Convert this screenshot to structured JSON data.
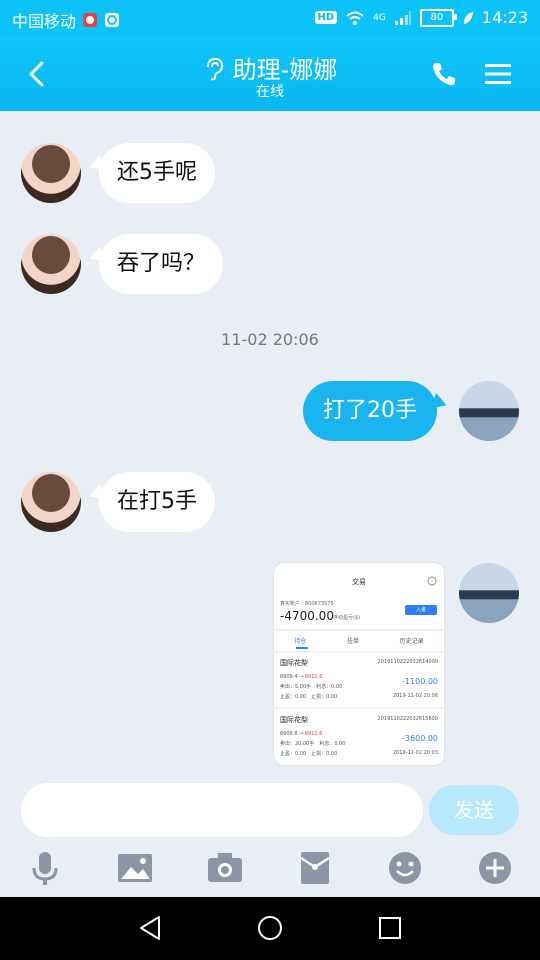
{
  "status_bar": {
    "carrier": "中国移动",
    "hd": "HD",
    "network": "4G",
    "battery": "80",
    "time": "14:23"
  },
  "header": {
    "title": "助理-娜娜",
    "subtitle": "在线"
  },
  "messages": [
    {
      "side": "in",
      "text": "还5手呢"
    },
    {
      "side": "in",
      "text": "吞了吗？"
    },
    {
      "timestamp": "11-02 20:06"
    },
    {
      "side": "out",
      "text": "打了20手"
    },
    {
      "side": "in",
      "text": "在打5手"
    }
  ],
  "trade_screenshot": {
    "title": "交易",
    "account_label": "真实账户：800673575",
    "balance": "-4700.00",
    "float_label": "浮动盈亏($)",
    "button": "入金",
    "tabs": [
      "持仓",
      "挂单",
      "历史记录"
    ],
    "orders": [
      {
        "name": "国际花梨",
        "order_no": "2019110222032614000",
        "open": "8909.4",
        "current": "8911.6",
        "lots_label": "卖出：5.00手",
        "profit_label": "利息：0.00",
        "stop_label": "止损：0.00",
        "take_label": "止盈：0.00",
        "pl": "-1100.00",
        "time": "2019-11-02 20:06"
      },
      {
        "name": "国际花梨",
        "order_no": "2019110222032615600",
        "open": "8909.8",
        "current": "8911.6",
        "lots_label": "卖出：20.00手",
        "profit_label": "利息：0.00",
        "stop_label": "止损：0.00",
        "take_label": "止盈：0.00",
        "pl": "-3600.00",
        "time": "2019-11-02 20:03"
      }
    ]
  },
  "composer": {
    "placeholder": "",
    "send_label": "发送"
  },
  "toolbar_icons": [
    "microphone-icon",
    "image-icon",
    "camera-icon",
    "red-packet-icon",
    "emoji-icon",
    "plus-icon"
  ],
  "colors": {
    "header": "#0cc2f6",
    "outgoing_bubble": "#1ab4ef",
    "background": "#e9edf4",
    "send_disabled": "#b7e8fb"
  }
}
